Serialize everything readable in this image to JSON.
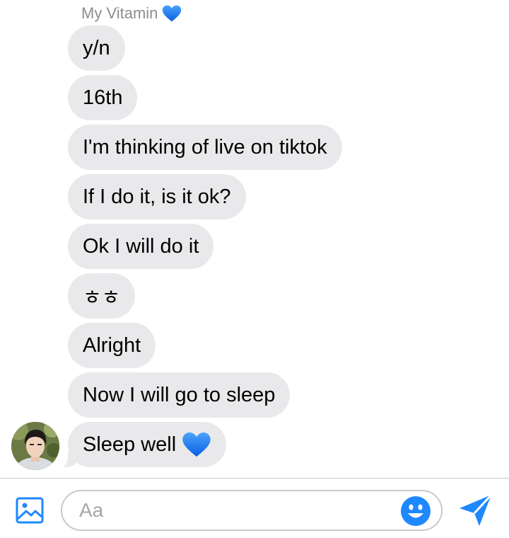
{
  "conversation": {
    "sender_name": "My Vitamin",
    "sender_emoji": "blue-heart-icon"
  },
  "messages": [
    {
      "text": "y/n"
    },
    {
      "text": "16th"
    },
    {
      "text": "I'm thinking of live on tiktok"
    },
    {
      "text": "If I do it, is it ok?"
    },
    {
      "text": "Ok I will do it"
    },
    {
      "text": "ㅎㅎ"
    },
    {
      "text": "Alright"
    },
    {
      "text": "Now I will go to sleep"
    },
    {
      "text": "Sleep well",
      "emoji": "blue-heart-icon"
    }
  ],
  "composer": {
    "placeholder": "Aa",
    "image_icon": "image-icon",
    "emoji_icon": "smiley-icon",
    "send_icon": "send-icon"
  },
  "colors": {
    "accent": "#1e88ff",
    "bubble": "#e9e9eb",
    "heart": "#1a73f0",
    "muted_text": "#8e8e93",
    "border": "#c9c9cc"
  }
}
